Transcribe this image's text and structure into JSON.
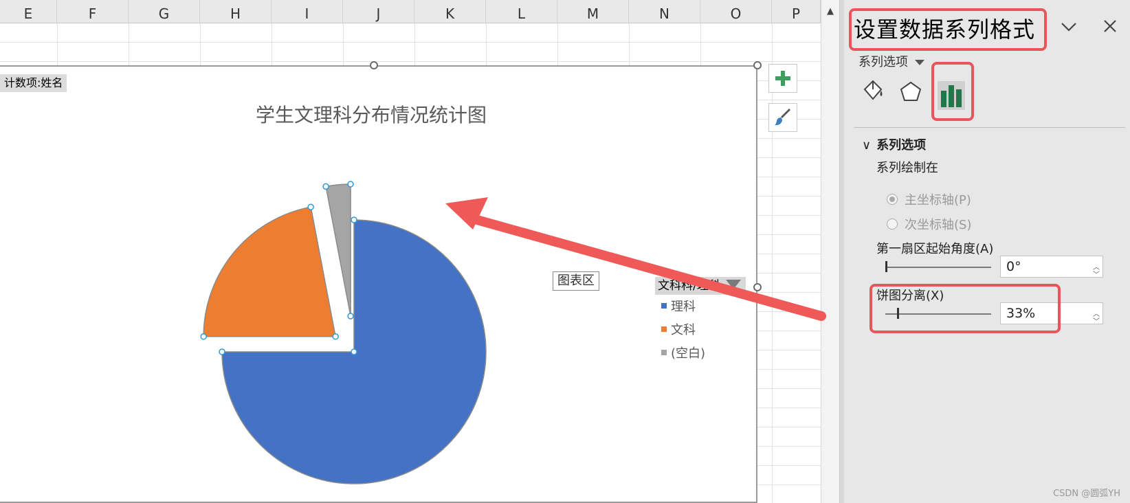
{
  "sheet": {
    "columns": [
      "E",
      "F",
      "G",
      "H",
      "I",
      "J",
      "K",
      "L",
      "M",
      "N",
      "O",
      "P"
    ]
  },
  "chart": {
    "pivot_field": "计数项:姓名",
    "title": "学生文理科分布情况统计图",
    "chart_area_tooltip": "图表区",
    "legend_field": "文科科/理科",
    "legend": [
      {
        "label": "理科",
        "color": "#4472c4"
      },
      {
        "label": "文科",
        "color": "#ed7d31"
      },
      {
        "label": "(空白)",
        "color": "#a5a5a5"
      }
    ],
    "add_element_icon": "plus-icon",
    "style_icon": "brush-icon"
  },
  "chart_data": {
    "type": "pie",
    "title": "学生文理科分布情况统计图",
    "categories": [
      "理科",
      "文科",
      "(空白)"
    ],
    "values": [
      75,
      22,
      3
    ],
    "colors": [
      "#4472c4",
      "#ed7d31",
      "#a5a5a5"
    ],
    "explosion_percent": 33,
    "first_slice_angle_deg": 0,
    "legend_position": "right"
  },
  "pane": {
    "title": "设置数据系列格式",
    "options_menu": "系列选项",
    "tabs": [
      {
        "icon": "paint-bucket-icon"
      },
      {
        "icon": "pentagon-icon"
      },
      {
        "icon": "bar-chart-icon",
        "selected": true
      }
    ],
    "section_header": "系列选项",
    "plot_series_on": "系列绘制在",
    "radio_primary": "主坐标轴(P)",
    "radio_secondary": "次坐标轴(S)",
    "first_slice_angle_label": "第一扇区起始角度(A)",
    "first_slice_angle_value": "0°",
    "pie_explosion_label": "饼图分离(X)",
    "pie_explosion_value": "33%",
    "highlight_color": "#e8555b"
  },
  "watermark": "CSDN @圆弧YH"
}
